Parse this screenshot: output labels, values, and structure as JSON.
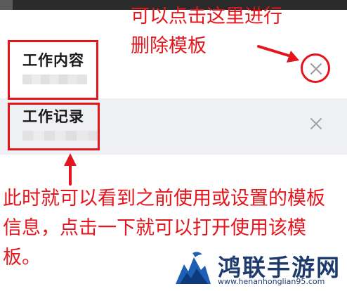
{
  "templates": [
    {
      "title": "工作内容",
      "close_icon": "close-x-icon"
    },
    {
      "title": "工作记录",
      "close_icon": "close-x-icon"
    }
  ],
  "annotations": {
    "top": "可以点击这里进行删除模板",
    "bottom": "此时就可以看到之前使用或设置的模板信息，点击一下就可以打开使用该模板。"
  },
  "watermark": {
    "brand": "鸿联手游网",
    "url": "www.henanhonglian95.com"
  },
  "colors": {
    "annotation": "#e4161d",
    "row_highlight": "#eef0f3",
    "watermark": "#1d3a6e"
  }
}
